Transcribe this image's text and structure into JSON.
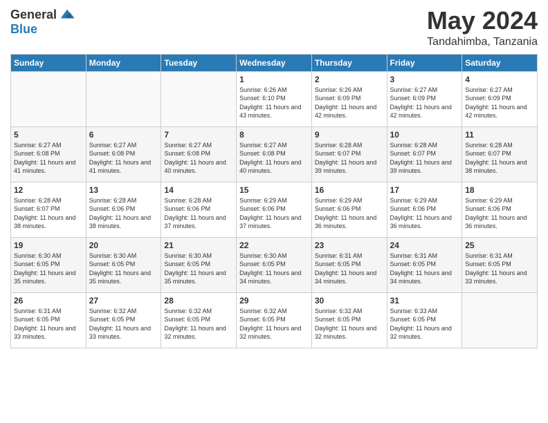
{
  "logo": {
    "general": "General",
    "blue": "Blue"
  },
  "title": "May 2024",
  "location": "Tandahimba, Tanzania",
  "days_of_week": [
    "Sunday",
    "Monday",
    "Tuesday",
    "Wednesday",
    "Thursday",
    "Friday",
    "Saturday"
  ],
  "weeks": [
    [
      {
        "day": "",
        "sunrise": "",
        "sunset": "",
        "daylight": ""
      },
      {
        "day": "",
        "sunrise": "",
        "sunset": "",
        "daylight": ""
      },
      {
        "day": "",
        "sunrise": "",
        "sunset": "",
        "daylight": ""
      },
      {
        "day": "1",
        "sunrise": "Sunrise: 6:26 AM",
        "sunset": "Sunset: 6:10 PM",
        "daylight": "Daylight: 11 hours and 43 minutes."
      },
      {
        "day": "2",
        "sunrise": "Sunrise: 6:26 AM",
        "sunset": "Sunset: 6:09 PM",
        "daylight": "Daylight: 11 hours and 42 minutes."
      },
      {
        "day": "3",
        "sunrise": "Sunrise: 6:27 AM",
        "sunset": "Sunset: 6:09 PM",
        "daylight": "Daylight: 11 hours and 42 minutes."
      },
      {
        "day": "4",
        "sunrise": "Sunrise: 6:27 AM",
        "sunset": "Sunset: 6:09 PM",
        "daylight": "Daylight: 11 hours and 42 minutes."
      }
    ],
    [
      {
        "day": "5",
        "sunrise": "Sunrise: 6:27 AM",
        "sunset": "Sunset: 6:08 PM",
        "daylight": "Daylight: 11 hours and 41 minutes."
      },
      {
        "day": "6",
        "sunrise": "Sunrise: 6:27 AM",
        "sunset": "Sunset: 6:08 PM",
        "daylight": "Daylight: 11 hours and 41 minutes."
      },
      {
        "day": "7",
        "sunrise": "Sunrise: 6:27 AM",
        "sunset": "Sunset: 6:08 PM",
        "daylight": "Daylight: 11 hours and 40 minutes."
      },
      {
        "day": "8",
        "sunrise": "Sunrise: 6:27 AM",
        "sunset": "Sunset: 6:08 PM",
        "daylight": "Daylight: 11 hours and 40 minutes."
      },
      {
        "day": "9",
        "sunrise": "Sunrise: 6:28 AM",
        "sunset": "Sunset: 6:07 PM",
        "daylight": "Daylight: 11 hours and 39 minutes."
      },
      {
        "day": "10",
        "sunrise": "Sunrise: 6:28 AM",
        "sunset": "Sunset: 6:07 PM",
        "daylight": "Daylight: 11 hours and 39 minutes."
      },
      {
        "day": "11",
        "sunrise": "Sunrise: 6:28 AM",
        "sunset": "Sunset: 6:07 PM",
        "daylight": "Daylight: 11 hours and 38 minutes."
      }
    ],
    [
      {
        "day": "12",
        "sunrise": "Sunrise: 6:28 AM",
        "sunset": "Sunset: 6:07 PM",
        "daylight": "Daylight: 11 hours and 38 minutes."
      },
      {
        "day": "13",
        "sunrise": "Sunrise: 6:28 AM",
        "sunset": "Sunset: 6:06 PM",
        "daylight": "Daylight: 11 hours and 38 minutes."
      },
      {
        "day": "14",
        "sunrise": "Sunrise: 6:28 AM",
        "sunset": "Sunset: 6:06 PM",
        "daylight": "Daylight: 11 hours and 37 minutes."
      },
      {
        "day": "15",
        "sunrise": "Sunrise: 6:29 AM",
        "sunset": "Sunset: 6:06 PM",
        "daylight": "Daylight: 11 hours and 37 minutes."
      },
      {
        "day": "16",
        "sunrise": "Sunrise: 6:29 AM",
        "sunset": "Sunset: 6:06 PM",
        "daylight": "Daylight: 11 hours and 36 minutes."
      },
      {
        "day": "17",
        "sunrise": "Sunrise: 6:29 AM",
        "sunset": "Sunset: 6:06 PM",
        "daylight": "Daylight: 11 hours and 36 minutes."
      },
      {
        "day": "18",
        "sunrise": "Sunrise: 6:29 AM",
        "sunset": "Sunset: 6:06 PM",
        "daylight": "Daylight: 11 hours and 36 minutes."
      }
    ],
    [
      {
        "day": "19",
        "sunrise": "Sunrise: 6:30 AM",
        "sunset": "Sunset: 6:05 PM",
        "daylight": "Daylight: 11 hours and 35 minutes."
      },
      {
        "day": "20",
        "sunrise": "Sunrise: 6:30 AM",
        "sunset": "Sunset: 6:05 PM",
        "daylight": "Daylight: 11 hours and 35 minutes."
      },
      {
        "day": "21",
        "sunrise": "Sunrise: 6:30 AM",
        "sunset": "Sunset: 6:05 PM",
        "daylight": "Daylight: 11 hours and 35 minutes."
      },
      {
        "day": "22",
        "sunrise": "Sunrise: 6:30 AM",
        "sunset": "Sunset: 6:05 PM",
        "daylight": "Daylight: 11 hours and 34 minutes."
      },
      {
        "day": "23",
        "sunrise": "Sunrise: 6:31 AM",
        "sunset": "Sunset: 6:05 PM",
        "daylight": "Daylight: 11 hours and 34 minutes."
      },
      {
        "day": "24",
        "sunrise": "Sunrise: 6:31 AM",
        "sunset": "Sunset: 6:05 PM",
        "daylight": "Daylight: 11 hours and 34 minutes."
      },
      {
        "day": "25",
        "sunrise": "Sunrise: 6:31 AM",
        "sunset": "Sunset: 6:05 PM",
        "daylight": "Daylight: 11 hours and 33 minutes."
      }
    ],
    [
      {
        "day": "26",
        "sunrise": "Sunrise: 6:31 AM",
        "sunset": "Sunset: 6:05 PM",
        "daylight": "Daylight: 11 hours and 33 minutes."
      },
      {
        "day": "27",
        "sunrise": "Sunrise: 6:32 AM",
        "sunset": "Sunset: 6:05 PM",
        "daylight": "Daylight: 11 hours and 33 minutes."
      },
      {
        "day": "28",
        "sunrise": "Sunrise: 6:32 AM",
        "sunset": "Sunset: 6:05 PM",
        "daylight": "Daylight: 11 hours and 32 minutes."
      },
      {
        "day": "29",
        "sunrise": "Sunrise: 6:32 AM",
        "sunset": "Sunset: 6:05 PM",
        "daylight": "Daylight: 11 hours and 32 minutes."
      },
      {
        "day": "30",
        "sunrise": "Sunrise: 6:32 AM",
        "sunset": "Sunset: 6:05 PM",
        "daylight": "Daylight: 11 hours and 32 minutes."
      },
      {
        "day": "31",
        "sunrise": "Sunrise: 6:33 AM",
        "sunset": "Sunset: 6:05 PM",
        "daylight": "Daylight: 11 hours and 32 minutes."
      },
      {
        "day": "",
        "sunrise": "",
        "sunset": "",
        "daylight": ""
      }
    ]
  ]
}
